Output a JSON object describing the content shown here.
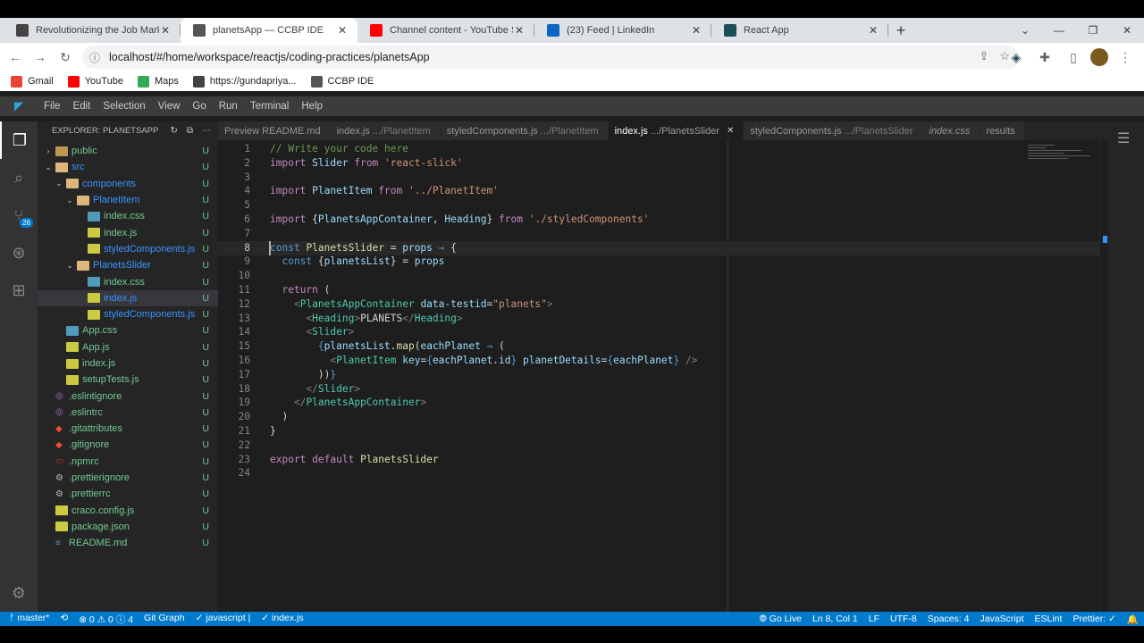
{
  "browser": {
    "tabs": [
      {
        "title": "Revolutionizing the Job Market |",
        "favicon_color": "#444444",
        "active": false
      },
      {
        "title": "planetsApp — CCBP IDE",
        "favicon_color": "#555555",
        "active": true
      },
      {
        "title": "Channel content - YouTube Studio",
        "favicon_color": "#ff0000",
        "active": false
      },
      {
        "title": "(23) Feed | LinkedIn",
        "favicon_color": "#0a66c2",
        "active": false
      },
      {
        "title": "React App",
        "favicon_color": "#1e4d5a",
        "active": false
      }
    ],
    "url": "localhost/#/home/workspace/reactjs/coding-practices/planetsApp",
    "bookmarks": [
      {
        "label": "Gmail",
        "color": "#ea4335"
      },
      {
        "label": "YouTube",
        "color": "#ff0000"
      },
      {
        "label": "Maps",
        "color": "#34a853"
      },
      {
        "label": "https://gundapriya...",
        "color": "#444444"
      },
      {
        "label": "CCBP IDE",
        "color": "#555555"
      }
    ]
  },
  "ide": {
    "menu": [
      "File",
      "Edit",
      "Selection",
      "View",
      "Go",
      "Run",
      "Terminal",
      "Help"
    ],
    "scm_badge": "26",
    "explorer_title": "EXPLORER: PLANETSAPP",
    "tree": [
      {
        "name": "public",
        "depth": 0,
        "kind": "folder",
        "chev": "›",
        "status": "U"
      },
      {
        "name": "src",
        "depth": 0,
        "kind": "folder-open",
        "chev": "⌄",
        "status": "U",
        "blue": true
      },
      {
        "name": "components",
        "depth": 1,
        "kind": "folder-open",
        "chev": "⌄",
        "status": "U",
        "blue": true
      },
      {
        "name": "PlanetItem",
        "depth": 2,
        "kind": "folder-open",
        "chev": "⌄",
        "status": "U",
        "blue": true
      },
      {
        "name": "index.css",
        "depth": 3,
        "kind": "css",
        "status": "U"
      },
      {
        "name": "index.js",
        "depth": 3,
        "kind": "js",
        "status": "U"
      },
      {
        "name": "styledComponents.js",
        "depth": 3,
        "kind": "js",
        "status": "U",
        "blue": true
      },
      {
        "name": "PlanetsSlider",
        "depth": 2,
        "kind": "folder-open",
        "chev": "⌄",
        "status": "U",
        "blue": true
      },
      {
        "name": "index.css",
        "depth": 3,
        "kind": "css",
        "status": "U"
      },
      {
        "name": "index.js",
        "depth": 3,
        "kind": "js",
        "status": "U",
        "blue": true,
        "selected": true
      },
      {
        "name": "styledComponents.js",
        "depth": 3,
        "kind": "js",
        "status": "U",
        "blue": true
      },
      {
        "name": "App.css",
        "depth": 1,
        "kind": "css",
        "status": "U"
      },
      {
        "name": "App.js",
        "depth": 1,
        "kind": "js",
        "status": "U"
      },
      {
        "name": "index.js",
        "depth": 1,
        "kind": "js",
        "status": "U"
      },
      {
        "name": "setupTests.js",
        "depth": 1,
        "kind": "js",
        "status": "U"
      },
      {
        "name": ".eslintignore",
        "depth": 0,
        "kind": "dot",
        "status": "U"
      },
      {
        "name": ".eslintrc",
        "depth": 0,
        "kind": "dot",
        "status": "U"
      },
      {
        "name": ".gitattributes",
        "depth": 0,
        "kind": "git",
        "status": "U"
      },
      {
        "name": ".gitignore",
        "depth": 0,
        "kind": "git",
        "status": "U"
      },
      {
        "name": ".npmrc",
        "depth": 0,
        "kind": "npm",
        "status": "U"
      },
      {
        "name": ".prettierignore",
        "depth": 0,
        "kind": "gear",
        "status": "U"
      },
      {
        "name": ".prettierrc",
        "depth": 0,
        "kind": "gear",
        "status": "U"
      },
      {
        "name": "craco.config.js",
        "depth": 0,
        "kind": "js",
        "status": "U"
      },
      {
        "name": "package.json",
        "depth": 0,
        "kind": "json",
        "status": "U"
      },
      {
        "name": "README.md",
        "depth": 0,
        "kind": "md",
        "status": "U"
      }
    ],
    "editor_tabs": [
      {
        "name": "Preview README.md",
        "desc": "",
        "active": false,
        "italic": false
      },
      {
        "name": "index.js",
        "desc": ".../PlanetItem",
        "active": false,
        "italic": false
      },
      {
        "name": "styledComponents.js",
        "desc": ".../PlanetItem",
        "active": false,
        "italic": false
      },
      {
        "name": "index.js",
        "desc": ".../PlanetsSlider",
        "active": true,
        "italic": false
      },
      {
        "name": "styledComponents.js",
        "desc": ".../PlanetsSlider",
        "active": false,
        "italic": false
      },
      {
        "name": "index.css",
        "desc": "",
        "active": false,
        "italic": true
      },
      {
        "name": "results",
        "desc": "",
        "active": false,
        "italic": false
      }
    ],
    "current_line": 8,
    "code_lines": [
      [
        [
          "c",
          "// Write your code here"
        ]
      ],
      [
        [
          "kc",
          "import"
        ],
        [
          "p",
          " "
        ],
        [
          "v",
          "Slider"
        ],
        [
          "p",
          " "
        ],
        [
          "kc",
          "from"
        ],
        [
          "p",
          " "
        ],
        [
          "s",
          "'react-slick'"
        ]
      ],
      [],
      [
        [
          "kc",
          "import"
        ],
        [
          "p",
          " "
        ],
        [
          "v",
          "PlanetItem"
        ],
        [
          "p",
          " "
        ],
        [
          "kc",
          "from"
        ],
        [
          "p",
          " "
        ],
        [
          "s",
          "'../PlanetItem'"
        ]
      ],
      [],
      [
        [
          "kc",
          "import"
        ],
        [
          "p",
          " {"
        ],
        [
          "v",
          "PlanetsAppContainer"
        ],
        [
          "p",
          ", "
        ],
        [
          "v",
          "Heading"
        ],
        [
          "p",
          "} "
        ],
        [
          "kc",
          "from"
        ],
        [
          "p",
          " "
        ],
        [
          "s",
          "'./styledComponents'"
        ]
      ],
      [],
      [
        [
          "k",
          "const"
        ],
        [
          "p",
          " "
        ],
        [
          "f",
          "PlanetsSlider"
        ],
        [
          "p",
          " = "
        ],
        [
          "v",
          "props"
        ],
        [
          "p",
          " "
        ],
        [
          "k",
          "⇒"
        ],
        [
          "p",
          " {"
        ]
      ],
      [
        [
          "p",
          "  "
        ],
        [
          "k",
          "const"
        ],
        [
          "p",
          " {"
        ],
        [
          "v",
          "planetsList"
        ],
        [
          "p",
          "} = "
        ],
        [
          "v",
          "props"
        ]
      ],
      [],
      [
        [
          "p",
          "  "
        ],
        [
          "kc",
          "return"
        ],
        [
          "p",
          " ("
        ]
      ],
      [
        [
          "p",
          "    "
        ],
        [
          "tg",
          "<"
        ],
        [
          "t",
          "PlanetsAppContainer"
        ],
        [
          "p",
          " "
        ],
        [
          "a",
          "data-testid"
        ],
        [
          "p",
          "="
        ],
        [
          "s",
          "\"planets\""
        ],
        [
          "tg",
          ">"
        ]
      ],
      [
        [
          "p",
          "      "
        ],
        [
          "tg",
          "<"
        ],
        [
          "t",
          "Heading"
        ],
        [
          "tg",
          ">"
        ],
        [
          "p",
          "PLANETS"
        ],
        [
          "tg",
          "</"
        ],
        [
          "t",
          "Heading"
        ],
        [
          "tg",
          ">"
        ]
      ],
      [
        [
          "p",
          "      "
        ],
        [
          "tg",
          "<"
        ],
        [
          "t",
          "Slider"
        ],
        [
          "tg",
          ">"
        ]
      ],
      [
        [
          "p",
          "        "
        ],
        [
          "k",
          "{"
        ],
        [
          "v",
          "planetsList"
        ],
        [
          "p",
          "."
        ],
        [
          "f",
          "map"
        ],
        [
          "p",
          "("
        ],
        [
          "v",
          "eachPlanet"
        ],
        [
          "p",
          " "
        ],
        [
          "k",
          "⇒"
        ],
        [
          "p",
          " ("
        ]
      ],
      [
        [
          "p",
          "          "
        ],
        [
          "tg",
          "<"
        ],
        [
          "t",
          "PlanetItem"
        ],
        [
          "p",
          " "
        ],
        [
          "a",
          "key"
        ],
        [
          "p",
          "="
        ],
        [
          "k",
          "{"
        ],
        [
          "v",
          "eachPlanet"
        ],
        [
          "p",
          "."
        ],
        [
          "v",
          "id"
        ],
        [
          "k",
          "}"
        ],
        [
          "p",
          " "
        ],
        [
          "a",
          "planetDetails"
        ],
        [
          "p",
          "="
        ],
        [
          "k",
          "{"
        ],
        [
          "v",
          "eachPlanet"
        ],
        [
          "k",
          "}"
        ],
        [
          "p",
          " "
        ],
        [
          "tg",
          "/>"
        ]
      ],
      [
        [
          "p",
          "        ))"
        ],
        [
          "k",
          "}"
        ]
      ],
      [
        [
          "p",
          "      "
        ],
        [
          "tg",
          "</"
        ],
        [
          "t",
          "Slider"
        ],
        [
          "tg",
          ">"
        ]
      ],
      [
        [
          "p",
          "    "
        ],
        [
          "tg",
          "</"
        ],
        [
          "t",
          "PlanetsAppContainer"
        ],
        [
          "tg",
          ">"
        ]
      ],
      [
        [
          "p",
          "  )"
        ]
      ],
      [
        [
          "p",
          "}"
        ]
      ],
      [],
      [
        [
          "kc",
          "export"
        ],
        [
          "p",
          " "
        ],
        [
          "kc",
          "default"
        ],
        [
          "p",
          " "
        ],
        [
          "f",
          "PlanetsSlider"
        ]
      ],
      []
    ],
    "status": {
      "left": [
        "ᚠ master*",
        "⟲",
        "⊗ 0 ⚠ 0 ⓘ 4",
        "Git Graph",
        "✓ javascript |",
        "✓ index.js"
      ],
      "right": [
        "⦾ Go Live",
        "Ln 8, Col 1",
        "LF",
        "UTF-8",
        "Spaces: 4",
        "JavaScript",
        "ESLint",
        "Prettier: ✓",
        "🔔"
      ]
    }
  }
}
